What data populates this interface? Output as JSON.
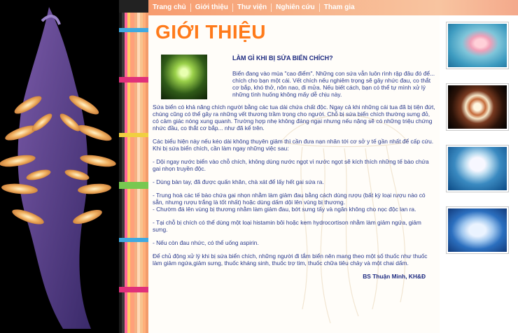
{
  "nav": {
    "items": [
      "Trang chủ",
      "Giới thiệu",
      "Thư viện",
      "Nghiên cứu",
      "Tham gia"
    ]
  },
  "page": {
    "title": "GIỚI THIỆU"
  },
  "article": {
    "heading": "LÀM GÌ KHI BỊ SỨA BIỂN CHÍCH?",
    "intro": "Biển đang vào mùa \"cao điểm\". Những con sứa vẫn luôn rình rập đâu đó để... chích cho bạn một cái. Vết chích nếu nghiêm trọng sẽ gây nhức đau, co thắt cơ bắp, khó thở, nôn nao, đi mửa. Nếu biết cách, bạn có thể tự mình xử lý những tình huống không mấy dễ chịu này.",
    "paragraphs": [
      "Sứa biển có khả năng chích người bằng các tua dài chứa chất độc. Ngay cả khi những cái tua đã bị tiện đứt, chúng cũng có thể gây ra những vết thương trầm trọng cho người. Chỗ bị sứa biển chích thường sưng đỏ, có cảm giác nóng xung quanh. Trường hợp nhẹ không đáng ngại nhưng nếu nặng sẽ có những triệu chứng nhức đầu, co thắt cơ bắp... như đã kể trên.",
      "Các biểu hiện này nếu kéo dài không thuyên giảm thì cần đưa nạn nhân tới cơ sở y tế gần nhất để cấp cứu. Khi bị sứa biển chích, cần làm ngay những việc sau:",
      "- Dội ngay nước biển vào chỗ chích, không dùng nước ngọt vì nước ngọt sẽ kích thích những tế bào chứa gai nhọn truyền độc.",
      "- Dùng bàn tay, đã được quấn khăn, chà xát để lấy hết gai sứa ra.",
      "- Trung hoà các tế bào chứa gai nhọn nhằm làm giảm đau bằng cách dùng rượu (bất kỳ loại rượu nào có sẵn, nhưng rượu trắng là tốt nhất) hoặc dùng dấm dội lên vùng bị thương.\n- Chườm đá lên vùng bị thương nhằm làm giảm đau, bớt sưng tấy và ngăn không cho nọc độc lan ra.",
      "- Tại chỗ bị chích có thể dùng một loại histamin bôi hoặc kem hydrocortison nhằm làm giảm ngứa, giảm sưng.",
      "- Nếu còn đau nhức, có thể uống aspirin.",
      "Để chủ động xử lý khi bị sứa biển chích, những người đi tắm biển nên mang theo một số thuốc như thuốc làm giảm ngứa,giảm sưng, thuốc kháng sinh, thuốc trợ tim, thuốc chữa tiêu chảy và một chai dấm."
    ],
    "signature": "BS Thuận Minh, KH&Đ"
  },
  "colors": {
    "title": "#ff7a1a",
    "body_text": "#2a3a8c",
    "nav_bar": "#f79b6e"
  },
  "images": {
    "left_photo": "nudibranch-photo",
    "inline_thumb": "green-jellyfish-photo",
    "right_thumbs": [
      "pink-jellyfish-photo",
      "brown-jellyfish-photo",
      "white-jellyfish-photo",
      "blue-jellyfish-photo"
    ]
  }
}
